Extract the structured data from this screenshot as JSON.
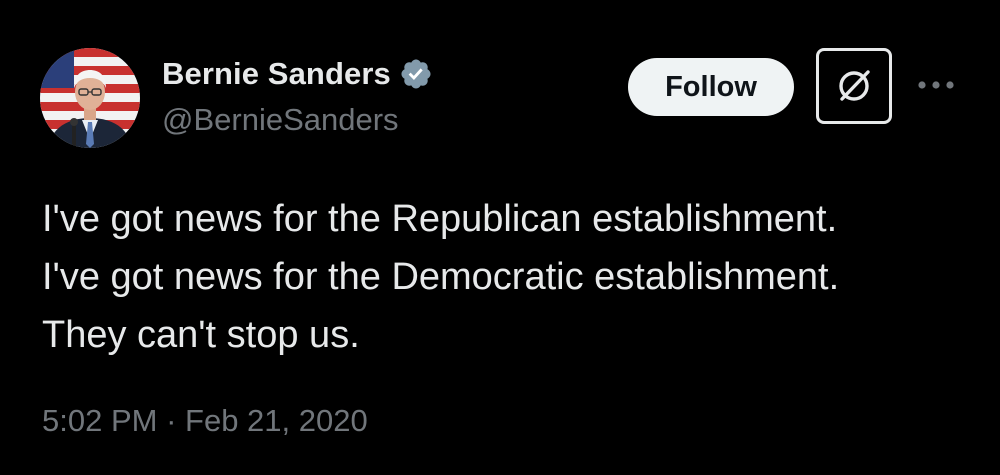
{
  "author": {
    "display_name": "Bernie Sanders",
    "handle": "@BernieSanders",
    "avatar": "profile-photo",
    "verified_icon": "verified-badge-icon",
    "verified_color": "#829aab"
  },
  "actions": {
    "follow_label": "Follow",
    "grok_icon": "grok-icon",
    "more_icon": "more-dots-icon"
  },
  "tweet": {
    "lines": [
      "I've got news for the Republican establishment.",
      "I've got news for the Democratic establishment.",
      "They can't stop us."
    ],
    "time": "5:02 PM",
    "separator": "·",
    "date": "Feb 21, 2020"
  },
  "colors": {
    "background": "#000000",
    "text_primary": "#e7e9ea",
    "text_secondary": "#71767b",
    "follow_bg": "#eff3f4"
  }
}
